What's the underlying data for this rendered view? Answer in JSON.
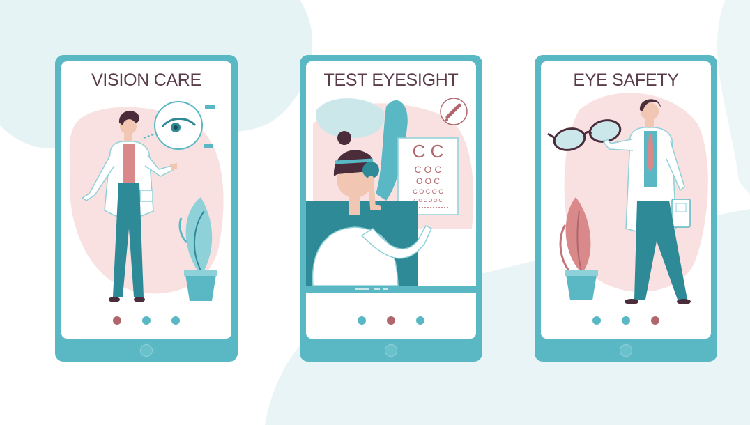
{
  "screens": [
    {
      "title": "VISION CARE",
      "active_dot": 0,
      "dot_count": 3
    },
    {
      "title": "TEST EYESIGHT",
      "active_dot": 1,
      "dot_count": 3
    },
    {
      "title": "EYE SAFETY",
      "active_dot": 2,
      "dot_count": 3
    }
  ],
  "colors": {
    "frame": "#5ab8c4",
    "title_text": "#5a3c4a",
    "dot_inactive": "#5ab8c4",
    "dot_active": "#b0666d",
    "blob_pink": "#f8e1e0",
    "background_wash": "#e8f4f5"
  }
}
